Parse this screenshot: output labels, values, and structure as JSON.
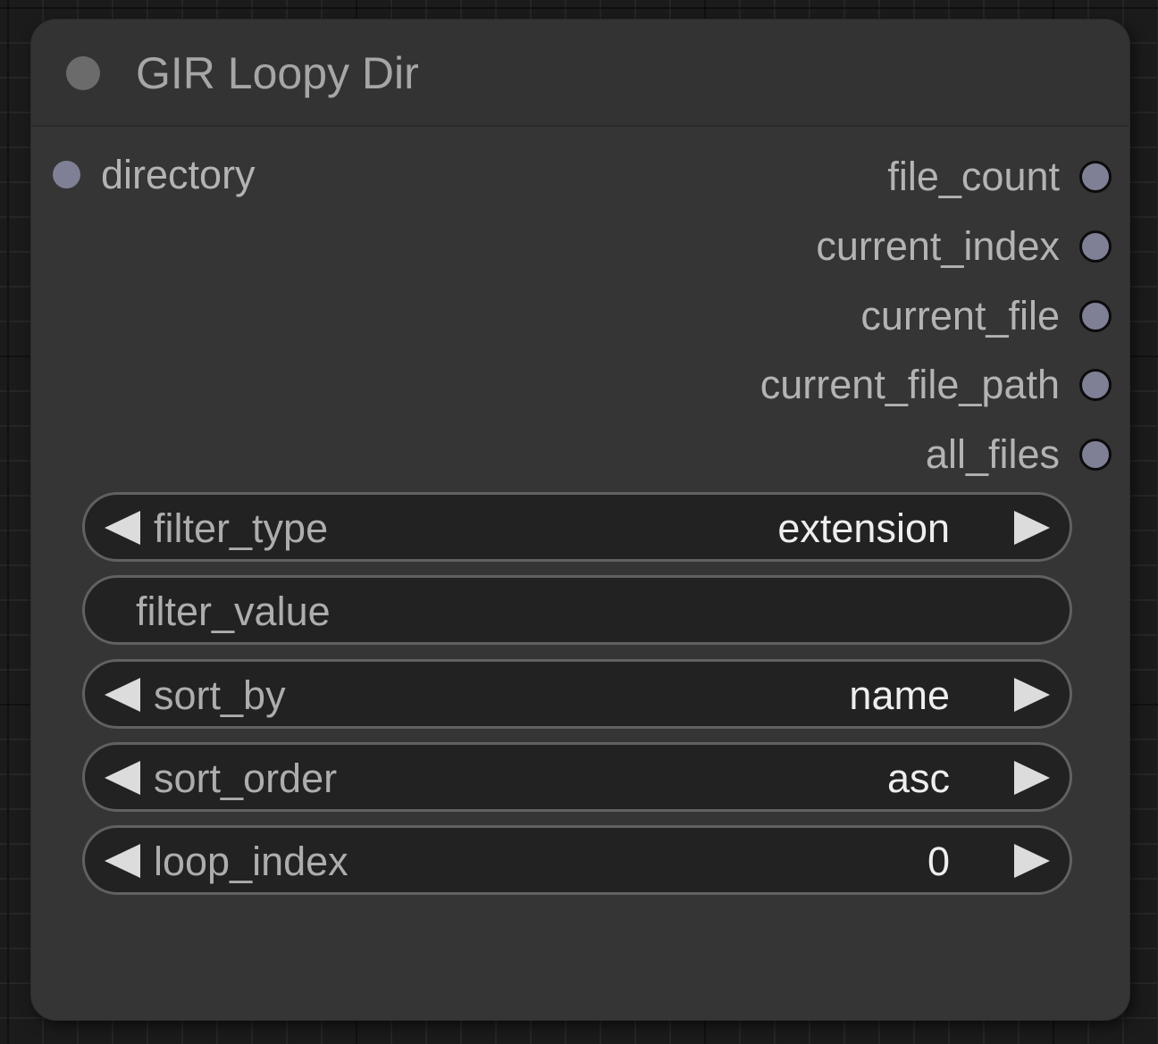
{
  "node": {
    "title": "GIR Loopy Dir",
    "inputs": [
      {
        "label": "directory"
      }
    ],
    "outputs": [
      {
        "label": "file_count"
      },
      {
        "label": "current_index"
      },
      {
        "label": "current_file"
      },
      {
        "label": "current_file_path"
      },
      {
        "label": "all_files"
      }
    ],
    "widgets": {
      "filter_type": {
        "label": "filter_type",
        "value": "extension"
      },
      "filter_value": {
        "label": "filter_value"
      },
      "sort_by": {
        "label": "sort_by",
        "value": "name"
      },
      "sort_order": {
        "label": "sort_order",
        "value": "asc"
      },
      "loop_index": {
        "label": "loop_index",
        "value": "0"
      }
    }
  },
  "colors": {
    "canvas_background": "#1b1b1b",
    "node_body": "#353535",
    "widget_background": "#222222",
    "slot_dot": "#7f7f95",
    "title_text": "#a6a6a6"
  }
}
